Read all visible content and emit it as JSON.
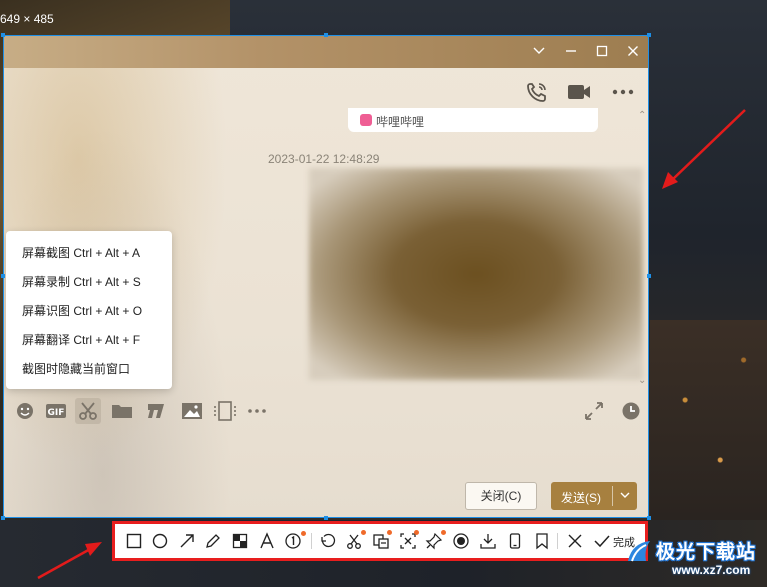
{
  "size_label": "649 × 485",
  "chat": {
    "contact_source_label": "哔哩哔哩",
    "timestamp": "2023-01-22 12:48:29",
    "close_button_label": "关闭(C)",
    "send_button_label": "发送(S)"
  },
  "context_menu": {
    "items": [
      {
        "label": "屏幕截图 Ctrl + Alt + A"
      },
      {
        "label": "屏幕录制 Ctrl + Alt + S"
      },
      {
        "label": "屏幕识图 Ctrl + Alt + O"
      },
      {
        "label": "屏幕翻译 Ctrl + Alt + F"
      },
      {
        "label": "截图时隐藏当前窗口"
      }
    ]
  },
  "capture_toolbar": {
    "done_label": "完成",
    "tools": [
      "rectangle-icon",
      "ellipse-icon",
      "arrow-icon",
      "pencil-icon",
      "mosaic-icon",
      "text-icon",
      "number-icon",
      "undo-icon",
      "long-screenshot-icon",
      "ocr-icon",
      "translate-icon",
      "pin-icon",
      "record-icon",
      "download-icon",
      "phone-icon",
      "bookmark-icon",
      "close-icon",
      "check-icon"
    ]
  },
  "watermark": {
    "site_name": "极光下载站",
    "site_url": "www.xz7.com"
  },
  "colors": {
    "selection_border": "#1e8fe6",
    "highlight_red": "#e81e1e",
    "send_button": "#a7803f",
    "badge_dot": "#ef6a2a"
  }
}
